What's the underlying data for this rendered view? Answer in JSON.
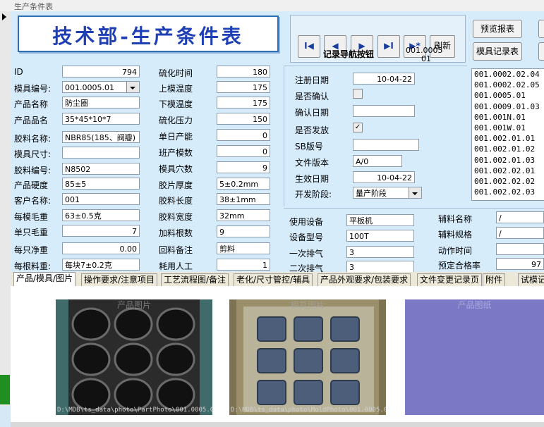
{
  "window": {
    "title": "生产条件表"
  },
  "banner": {
    "title": "技术部-生产条件表"
  },
  "nav": {
    "buttons": [
      "I◀",
      "◀",
      "▶",
      "▶I",
      "▶*"
    ],
    "refresh": "刷新",
    "label": "记录导航按钮",
    "record_1": "001.0005",
    "record_2": "01"
  },
  "actions": {
    "preview": "预览报表",
    "mold_record": "模具记录表"
  },
  "col1": [
    {
      "label": "ID",
      "value": "794",
      "align": "r"
    },
    {
      "label": "模具编号:",
      "value": "001.0005.01",
      "dropdown": true
    },
    {
      "label": "产品名称",
      "value": "防尘圈"
    },
    {
      "label": "产品品名",
      "value": "35*45*10*7"
    },
    {
      "label": "胶料名称:",
      "value": "NBR85(185、阀瓣)"
    },
    {
      "label": "模具尺寸:",
      "value": ""
    },
    {
      "label": "胶料编号:",
      "value": "N8502"
    },
    {
      "label": "产品硬度",
      "value": "85±5"
    },
    {
      "label": "客户名称:",
      "value": "001"
    },
    {
      "label": "每模毛重",
      "value": "63±0.5克"
    },
    {
      "label": "单只毛重",
      "value": "7",
      "align": "r"
    },
    {
      "label": "每只净重",
      "value": "0.00",
      "align": "r"
    },
    {
      "label": "每根料重:",
      "value": "每块7±0.2克"
    }
  ],
  "col2": [
    {
      "label": "硫化时间",
      "value": "180",
      "align": "r"
    },
    {
      "label": "上模温度",
      "value": "175",
      "align": "r"
    },
    {
      "label": "下模温度",
      "value": "175",
      "align": "r"
    },
    {
      "label": "硫化压力",
      "value": "150",
      "align": "r"
    },
    {
      "label": "单日产能",
      "value": "0",
      "align": "r"
    },
    {
      "label": "班产模数",
      "value": "0",
      "align": "r"
    },
    {
      "label": "模具穴数",
      "value": "9",
      "align": "r"
    },
    {
      "label": "胶片厚度",
      "value": "5±0.2mm"
    },
    {
      "label": "胶料长度",
      "value": "38±1mm"
    },
    {
      "label": "胶料宽度",
      "value": "32mm"
    },
    {
      "label": "加料根数",
      "value": "9"
    },
    {
      "label": "回料备注",
      "value": "剪料"
    },
    {
      "label": "耗用人工",
      "value": "1",
      "align": "r"
    }
  ],
  "col3": {
    "register_date": {
      "label": "注册日期",
      "value": "10-04-22"
    },
    "confirmed": {
      "label": "是否确认",
      "checked": false
    },
    "confirm_date": {
      "label": "确认日期",
      "value": ""
    },
    "released": {
      "label": "是否发放",
      "checked": true
    },
    "sb_no": {
      "label": "SB版号",
      "value": ""
    },
    "doc_version": {
      "label": "文件版本",
      "value": "A/0"
    },
    "effective_date": {
      "label": "生效日期",
      "value": "10-04-22"
    },
    "dev_stage": {
      "label": "开发阶段:",
      "value": "量产阶段"
    }
  },
  "mold_list": [
    "001.0002.02.04",
    "001.0002.02.05",
    "001.0005.01",
    "001.0009.01.03",
    "001.001N.01",
    "001.001W.01",
    "001.002.01.01",
    "001.002.01.02",
    "001.002.01.03",
    "001.002.02.01",
    "001.002.02.02",
    "001.002.02.03"
  ],
  "equipment": [
    {
      "label": "使用设备",
      "value": "平板机"
    },
    {
      "label": "设备型号",
      "value": "100T"
    },
    {
      "label": "一次排气",
      "value": "3"
    },
    {
      "label": "二次排气",
      "value": "3"
    }
  ],
  "aux": [
    {
      "label": "辅料名称",
      "value": "/"
    },
    {
      "label": "辅料规格",
      "value": "/"
    },
    {
      "label": "动作时间",
      "value": ""
    },
    {
      "label": "预定合格率",
      "value": "97"
    }
  ],
  "tabs": [
    "产品/模具/图片",
    "操作要求/注意项目",
    "工艺流程图/备注",
    "老化/尺寸管控/辅具",
    "产品外观要求/包装要求",
    "文件变更记录页",
    "附件",
    "试模记"
  ],
  "photos": [
    {
      "caption": "产品图片",
      "path": "D:\\MDB\\ts_data\\photo\\PartPhoto\\001.0005.01.JPG"
    },
    {
      "caption": "模具图片",
      "path": "D:\\MDB\\ts_data\\photo\\MoldPhoto\\001.0005.01.JPG"
    },
    {
      "caption": "产品图纸",
      "path": ""
    }
  ],
  "colors": {
    "form_bg": "#d7ecfb",
    "banner_text": "#1f3fb5",
    "drawing_placeholder": "#7b78c6"
  }
}
